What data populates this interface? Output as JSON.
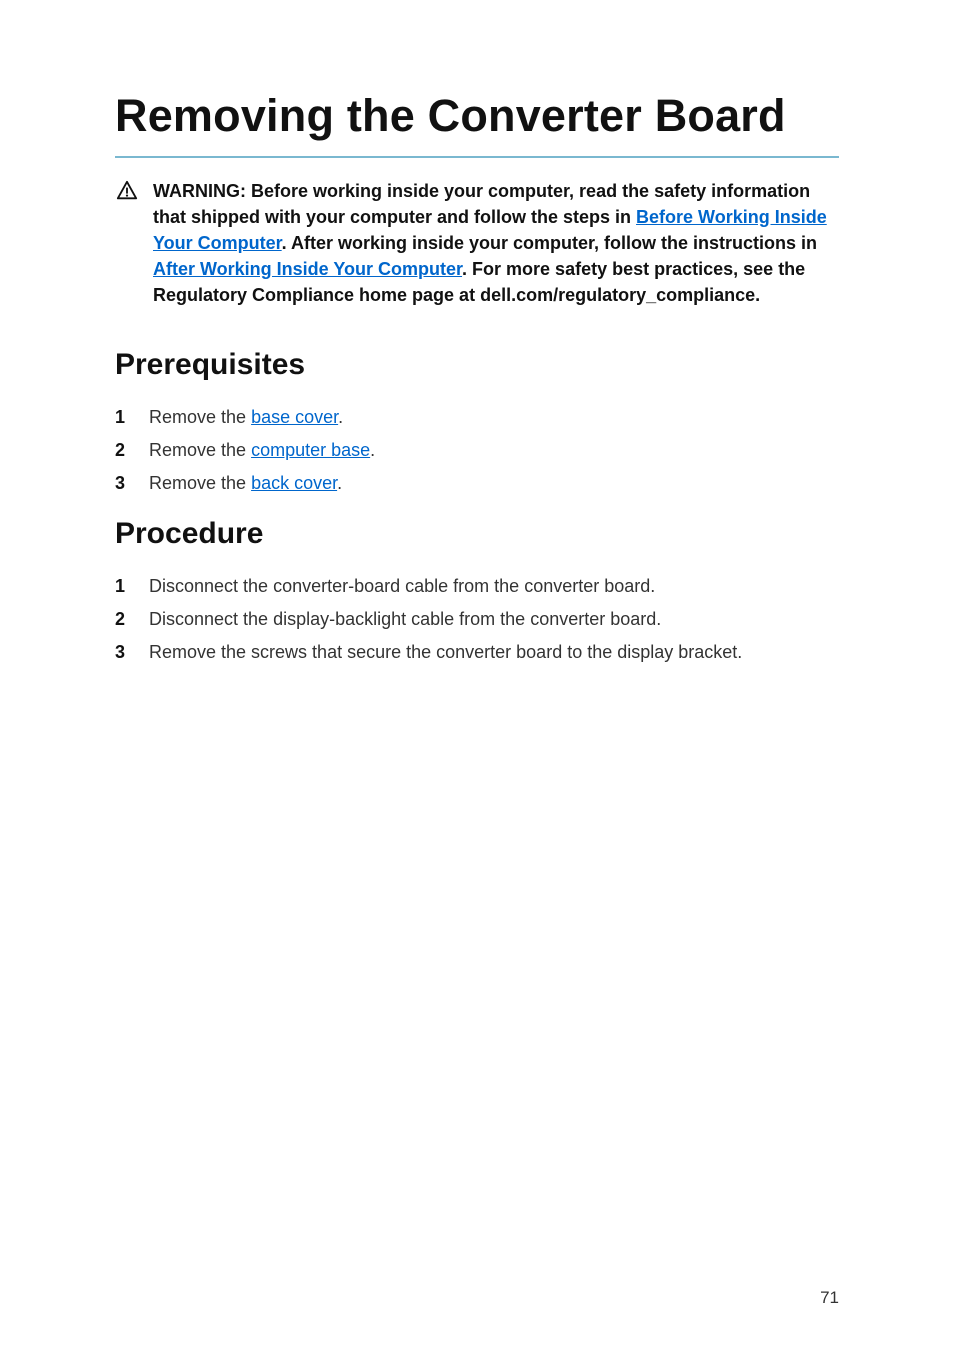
{
  "title": "Removing the Converter Board",
  "warning": {
    "prefix": "WARNING: Before working inside your computer, read the safety information that shipped with your computer and follow the steps in ",
    "link1_text": "Before Working Inside Your Computer",
    "mid1": ". After working inside your computer, follow the instructions in ",
    "link2_text": "After Working Inside Your Computer",
    "suffix": ". For more safety best practices, see the Regulatory Compliance home page at dell.com/regulatory_compliance."
  },
  "sections": {
    "prereq_heading": "Prerequisites",
    "prereq_items": [
      {
        "pre": "Remove the ",
        "link": "base cover",
        "post": "."
      },
      {
        "pre": "Remove the ",
        "link": "computer base",
        "post": "."
      },
      {
        "pre": "Remove the ",
        "link": "back cover",
        "post": "."
      }
    ],
    "proc_heading": "Procedure",
    "proc_items": [
      "Disconnect the converter-board cable from the converter board.",
      "Disconnect the display-backlight cable from the converter board.",
      "Remove the screws that secure the converter board to the display bracket."
    ]
  },
  "page_number": "71"
}
